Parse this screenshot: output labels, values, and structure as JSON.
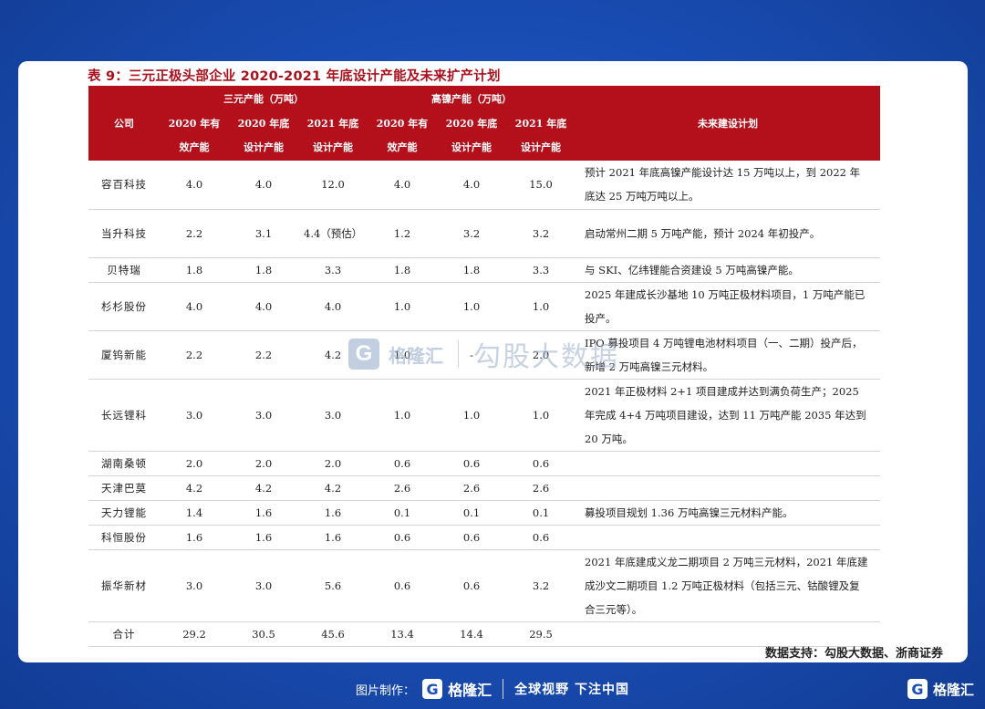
{
  "title": "表 9：三元正极头部企业 2020-2021 年底设计产能及未来扩产计划",
  "table": {
    "header_company": "公司",
    "group1": "三元产能（万吨）",
    "group2": "高镍产能（万吨）",
    "header_plan": "未来建设计划",
    "sub": [
      {
        "l1": "2020 年有",
        "l2": "效产能"
      },
      {
        "l1": "2020 年底",
        "l2": "设计产能"
      },
      {
        "l1": "2021 年底",
        "l2": "设计产能"
      },
      {
        "l1": "2020 年有",
        "l2": "效产能"
      },
      {
        "l1": "2020 年底",
        "l2": "设计产能"
      },
      {
        "l1": "2021 年底",
        "l2": "设计产能"
      }
    ],
    "rows": [
      {
        "company": "容百科技",
        "v": [
          "4.0",
          "4.0",
          "12.0",
          "4.0",
          "4.0",
          "15.0"
        ],
        "plan": "预计 2021 年底高镍产能设计达 15 万吨以上，到 2022 年底达 25 万吨万吨以上。"
      },
      {
        "company": "当升科技",
        "v": [
          "2.2",
          "3.1",
          "4.4（预估）",
          "1.2",
          "3.2",
          "3.2"
        ],
        "plan": "启动常州二期 5 万吨产能，预计 2024 年初投产。"
      },
      {
        "company": "贝特瑞",
        "v": [
          "1.8",
          "1.8",
          "3.3",
          "1.8",
          "1.8",
          "3.3"
        ],
        "plan": "与 SKI、亿纬锂能合资建设 5 万吨高镍产能。"
      },
      {
        "company": "杉杉股份",
        "v": [
          "4.0",
          "4.0",
          "4.0",
          "1.0",
          "1.0",
          "1.0"
        ],
        "plan": "2025 年建成长沙基地 10 万吨正极材料项目，1 万吨产能已投产。"
      },
      {
        "company": "厦钨新能",
        "v": [
          "2.2",
          "2.2",
          "4.2",
          "1.0",
          "-",
          "2.0"
        ],
        "plan": "IPO 募投项目 4 万吨锂电池材料项目（一、二期）投产后，新增 2 万吨高镍三元材料。"
      },
      {
        "company": "长远锂科",
        "v": [
          "3.0",
          "3.0",
          "3.0",
          "1.0",
          "1.0",
          "1.0"
        ],
        "plan": "2021 年正极材料 2+1 项目建成并达到满负荷生产；2025 年完成 4+4 万吨项目建设，达到 11 万吨产能 2035 年达到 20 万吨。"
      },
      {
        "company": "湖南桑顿",
        "v": [
          "2.0",
          "2.0",
          "2.0",
          "0.6",
          "0.6",
          "0.6"
        ],
        "plan": ""
      },
      {
        "company": "天津巴莫",
        "v": [
          "4.2",
          "4.2",
          "4.2",
          "2.6",
          "2.6",
          "2.6"
        ],
        "plan": ""
      },
      {
        "company": "天力锂能",
        "v": [
          "1.4",
          "1.6",
          "1.6",
          "0.1",
          "0.1",
          "0.1"
        ],
        "plan": "募投项目规划 1.36 万吨高镍三元材料产能。"
      },
      {
        "company": "科恒股份",
        "v": [
          "1.6",
          "1.6",
          "1.6",
          "0.6",
          "0.6",
          "0.6"
        ],
        "plan": ""
      },
      {
        "company": "振华新材",
        "v": [
          "3.0",
          "3.0",
          "5.6",
          "0.6",
          "0.6",
          "3.2"
        ],
        "plan": "2021 年底建成义龙二期项目 2 万吨三元材料，2021 年底建成沙文二期项目 1.2 万吨正极材料（包括三元、钴酸锂及复合三元等）。"
      },
      {
        "company": "合计",
        "v": [
          "29.2",
          "30.5",
          "45.6",
          "13.4",
          "14.4",
          "29.5"
        ],
        "plan": ""
      }
    ]
  },
  "source": "数据支持：勾股大数据、浙商证券",
  "watermark": {
    "logo_char": "G",
    "brand": "格隆汇",
    "text": "勾股大数据"
  },
  "footer": {
    "made_by": "图片制作：",
    "logo_char": "G",
    "brand": "格隆汇",
    "slogan": "全球视野 下注中国"
  },
  "corner": {
    "logo_char": "G",
    "brand": "格隆汇"
  },
  "colors": {
    "header_red": "#b3101c",
    "title_red": "#a8111d",
    "bg_blue": "#1a4fb8"
  }
}
